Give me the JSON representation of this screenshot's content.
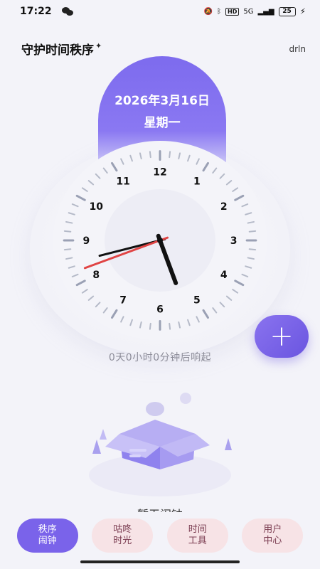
{
  "status_bar": {
    "time": "17:22",
    "network": "5G",
    "battery": "25"
  },
  "header": {
    "app_title": "守护时间秩序",
    "user_name": "drln"
  },
  "date_card": {
    "date": "2026年3月16日",
    "weekday": "星期一"
  },
  "clock": {
    "numbers": [
      "12",
      "1",
      "2",
      "3",
      "4",
      "5",
      "6",
      "7",
      "8",
      "9",
      "10",
      "11"
    ],
    "hour": 5,
    "minute": 22,
    "second": 39,
    "hand_color": "#111111",
    "second_hand_color": "#e04444"
  },
  "countdown_text": "0天0小时0分钟后响起",
  "add_button": {
    "label": "+"
  },
  "empty_state": {
    "text": "暂无闹钟"
  },
  "bottom_nav": {
    "items": [
      {
        "label": "秩序\n闹钟",
        "active": true
      },
      {
        "label": "咕咚\n时光",
        "active": false
      },
      {
        "label": "时间\n工具",
        "active": false
      },
      {
        "label": "用户\n中心",
        "active": false
      }
    ]
  },
  "colors": {
    "accent": "#7a63ea",
    "nav_inactive_bg": "#f7e3e6",
    "nav_inactive_text": "#7a3b50"
  }
}
